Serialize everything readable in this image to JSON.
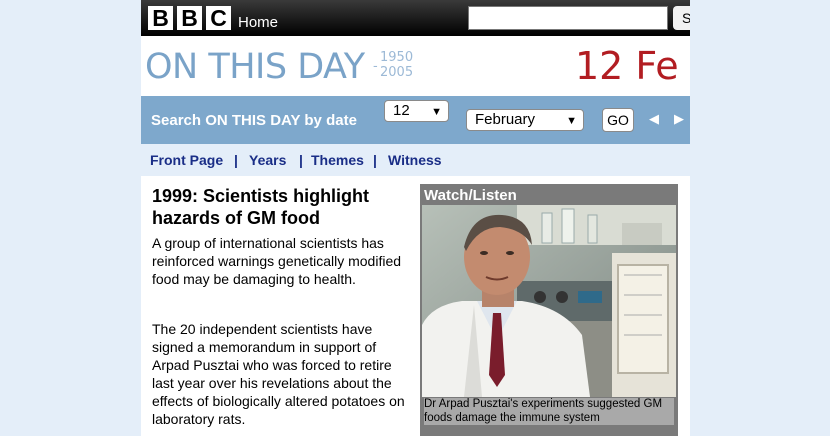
{
  "header": {
    "logo_letters": [
      "B",
      "B",
      "C"
    ],
    "home_label": "Home",
    "search_value": "",
    "search_button_label": "S"
  },
  "banner": {
    "title": "ON THIS DAY",
    "years_start": "1950",
    "years_end": "2005",
    "date": "12 Fe"
  },
  "date_search": {
    "label": "Search ON THIS DAY by date",
    "day_value": "12",
    "month_value": "February",
    "go_label": "GO",
    "prev_arrow": "◀",
    "next_arrow": "▶"
  },
  "nav": {
    "items": [
      "Front Page",
      "Years",
      "Themes",
      "Witness"
    ],
    "separator": "|"
  },
  "article": {
    "headline": "1999: Scientists highlight hazards of GM food",
    "paragraphs": [
      "A group of international scientists has reinforced warnings genetically modified food may be damaging to health.",
      "The 20 independent scientists have signed a memorandum in support of Arpad Pusztai who was forced to retire last year over his revelations about the effects of biologically altered potatoes on laboratory rats."
    ]
  },
  "watch_listen": {
    "title": "Watch/Listen",
    "caption": "Dr Arpad Pusztai's experiments suggested GM foods damage the immune system"
  },
  "colors": {
    "page_bg": "#e4eef9",
    "banner_title": "#7aa3c8",
    "date_red": "#b21d22",
    "search_bar": "#7ea8cc",
    "nav_link": "#1a2e87"
  },
  "icons": [
    "chevron-down-icon",
    "prev-arrow-icon",
    "next-arrow-icon"
  ]
}
